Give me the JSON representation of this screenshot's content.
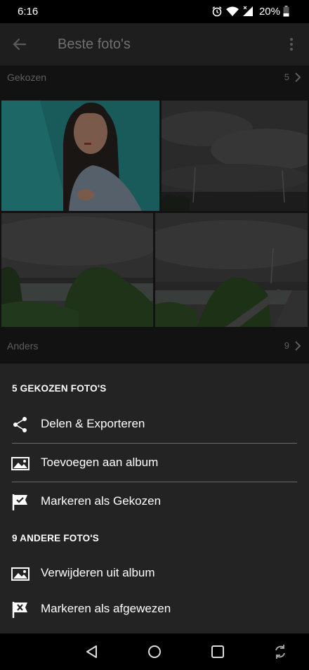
{
  "status_bar": {
    "time": "6:16",
    "battery": "20%"
  },
  "app_bar": {
    "title": "Beste foto's",
    "back_icon": "arrow-back-icon",
    "menu_icon": "more-vertical-icon"
  },
  "sections": {
    "picked": {
      "label": "Gekozen",
      "count": "5"
    },
    "other": {
      "label": "Anders",
      "count": "9"
    }
  },
  "sheet": {
    "picked_heading": "5 GEKOZEN FOTO'S",
    "other_heading": "9 ANDERE FOTO'S",
    "items": [
      {
        "label": "Delen & Exporteren",
        "icon": "share-icon"
      },
      {
        "label": "Toevoegen aan album",
        "icon": "album-icon"
      },
      {
        "label": "Markeren als Gekozen",
        "icon": "flag-pick-icon"
      },
      {
        "label": "Verwijderen uit album",
        "icon": "album-icon"
      },
      {
        "label": "Markeren als afgewezen",
        "icon": "flag-reject-icon"
      }
    ]
  },
  "colors": {
    "sheet_bg": "#232323",
    "photo_teal": "#2aa5a3"
  }
}
